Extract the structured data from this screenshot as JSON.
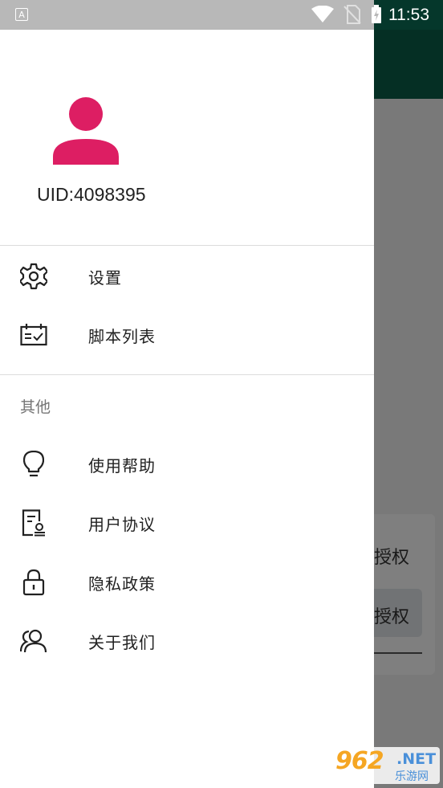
{
  "status_bar": {
    "left_badge": "A",
    "time": "11:53",
    "icons": [
      "wifi-icon",
      "no-sim-icon",
      "battery-charging-icon"
    ]
  },
  "drawer": {
    "uid": "UID:4098395",
    "avatar_color": "#dd1e63",
    "primary_items": [
      {
        "label": "设置",
        "icon": "gear-icon"
      },
      {
        "label": "脚本列表",
        "icon": "script-list-icon"
      }
    ],
    "section_title": "其他",
    "other_items": [
      {
        "label": "使用帮助",
        "icon": "lightbulb-icon"
      },
      {
        "label": "用户协议",
        "icon": "agreement-icon"
      },
      {
        "label": "隐私政策",
        "icon": "lock-icon"
      },
      {
        "label": "关于我们",
        "icon": "people-icon"
      }
    ]
  },
  "background": {
    "auth_text": "授权",
    "auth_button": "授权",
    "toolbar_color": "#0b5e48"
  },
  "watermark": {
    "logo": "962",
    "suffix": ".NET",
    "subtitle": "乐游网"
  }
}
